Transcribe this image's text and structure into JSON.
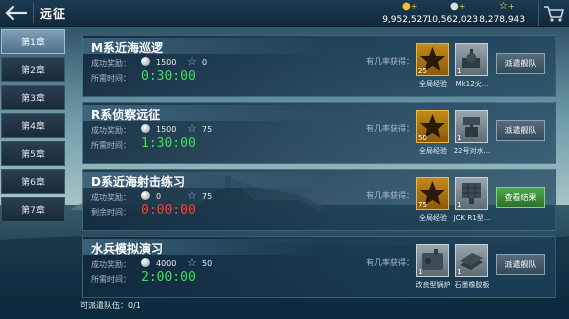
{
  "header": {
    "title": "远征",
    "back_icon": "back-arrow-icon",
    "resources": [
      {
        "icon": "gold-coin-icon",
        "value": "9,952,527",
        "color": "#f2c230"
      },
      {
        "icon": "silver-coin-icon",
        "value": "10,562,023",
        "color": "#d9dee3"
      },
      {
        "icon": "star-icon",
        "value": "8,278,943",
        "color": "#f2e6a0"
      }
    ],
    "shop_icon": "shopping-cart-icon"
  },
  "sidebar": {
    "chapters": [
      "第1章",
      "第2章",
      "第3章",
      "第4章",
      "第5章",
      "第6章",
      "第7章"
    ],
    "active_index": 0
  },
  "labels": {
    "reward": "成功奖励：",
    "time_needed": "所需时间：",
    "time_left": "剩余时间：",
    "chance": "有几率获得："
  },
  "missions": [
    {
      "title": "M系近海巡逻",
      "coins": "1500",
      "stars": "0",
      "time_label": "time_needed",
      "time": "0:30:00",
      "time_color": "green",
      "rewards": [
        {
          "type": "star-medal-icon",
          "count": "25",
          "name": "全局经验"
        },
        {
          "type": "ship-turret-icon",
          "count": "1",
          "name": "Mk12火..."
        }
      ],
      "button": "派遣舰队",
      "button_style": "normal"
    },
    {
      "title": "R系侦察远征",
      "coins": "1500",
      "stars": "75",
      "time_label": "time_needed",
      "time": "1:30:00",
      "time_color": "green",
      "rewards": [
        {
          "type": "star-medal-icon",
          "count": "50",
          "name": "全局经验"
        },
        {
          "type": "radar-turret-icon",
          "count": "1",
          "name": "22号对水..."
        }
      ],
      "button": "派遣舰队",
      "button_style": "normal"
    },
    {
      "title": "D系近海射击练习",
      "coins": "0",
      "stars": "75",
      "time_label": "time_left",
      "time": "0:00:00",
      "time_color": "red",
      "rewards": [
        {
          "type": "star-medal-icon",
          "count": "75",
          "name": "全局经验"
        },
        {
          "type": "radar-array-icon",
          "count": "1",
          "name": "JCK R1型..."
        }
      ],
      "button": "查看结果",
      "button_style": "green"
    },
    {
      "title": "水兵模拟演习",
      "coins": "4000",
      "stars": "50",
      "time_label": "time_needed",
      "time": "2:00:00",
      "time_color": "green",
      "rewards": [
        {
          "type": "boiler-icon",
          "count": "1",
          "name": "改良型锅炉"
        },
        {
          "type": "rubber-panel-icon",
          "count": "1",
          "name": "石墨橡胶板"
        }
      ],
      "button": "派遣舰队",
      "button_style": "normal"
    }
  ],
  "footer": {
    "label": "可派遣队伍：",
    "value": "0/1"
  }
}
